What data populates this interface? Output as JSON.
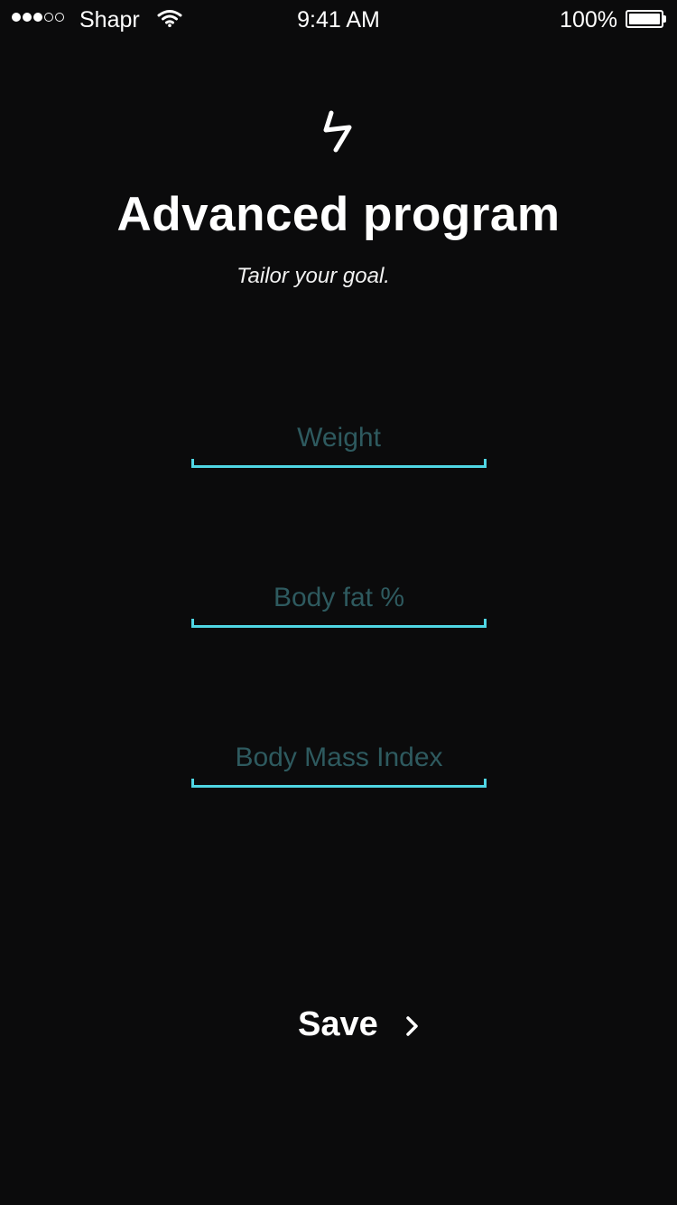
{
  "status_bar": {
    "signal_bars_filled": 3,
    "signal_bars_total": 5,
    "carrier": "Shapr",
    "time": "9:41 AM",
    "battery_percent": "100%",
    "battery_level": 1.0
  },
  "header": {
    "logo_icon": "lightning-bolt-icon",
    "title": "Advanced program",
    "subtitle": "Tailor your goal."
  },
  "form": {
    "fields": [
      {
        "placeholder": "Weight",
        "value": ""
      },
      {
        "placeholder": "Body fat %",
        "value": ""
      },
      {
        "placeholder": "Body Mass Index",
        "value": ""
      }
    ],
    "underline_color": "#4fd6e4",
    "placeholder_color": "#2e5a5f"
  },
  "actions": {
    "save_label": "Save",
    "save_icon": "chevron-right-icon"
  },
  "colors": {
    "background": "#0b0b0c",
    "text": "#ffffff",
    "accent": "#4fd6e4"
  }
}
